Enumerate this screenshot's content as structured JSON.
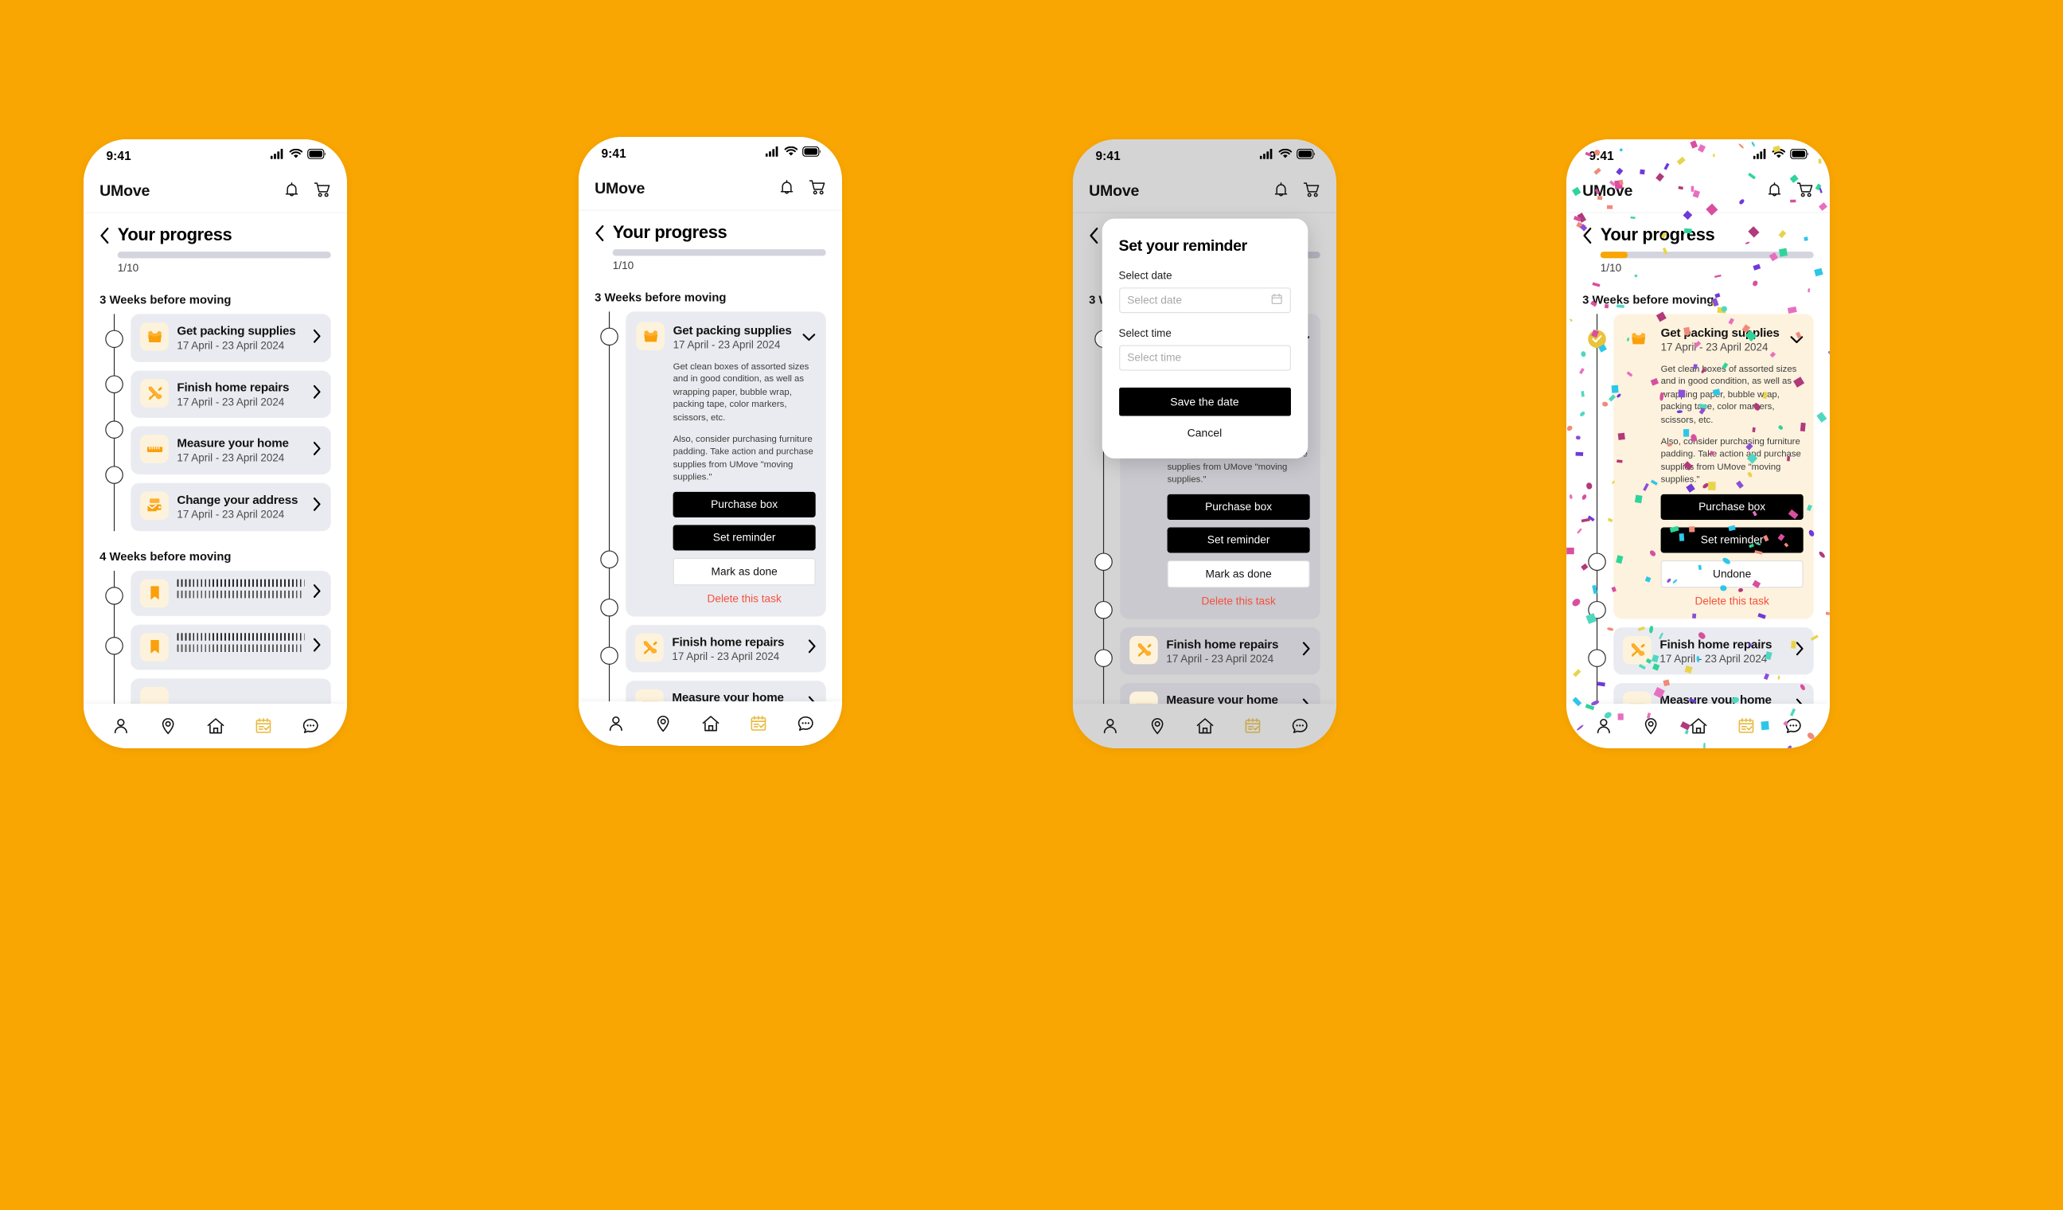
{
  "background_color": "#F9A602",
  "status_bar": {
    "time": "9:41",
    "icons": [
      "signal-icon",
      "wifi-icon",
      "battery-icon"
    ]
  },
  "app_bar": {
    "brand": "UMove",
    "icons": [
      "bell-icon",
      "cart-icon"
    ]
  },
  "page": {
    "title": "Your progress",
    "progress_label": "1/10",
    "progress_percent_empty": 0,
    "progress_percent_filled": 13
  },
  "sections": [
    {
      "title": "3 Weeks before moving"
    },
    {
      "title": "4 Weeks before moving"
    }
  ],
  "tasks": [
    {
      "icon": "box-icon",
      "title": "Get packing supplies",
      "dates": "17 April - 23 April 2024"
    },
    {
      "icon": "tools-icon",
      "title": "Finish home repairs",
      "dates": "17 April - 23 April 2024"
    },
    {
      "icon": "ruler-icon",
      "title": "Measure your home",
      "dates": "17 April - 23 April 2024"
    },
    {
      "icon": "mail-icon",
      "title": "Change your address",
      "dates": "17 April - 23 April 2024"
    }
  ],
  "placeholder_tasks": [
    {
      "icon": "bookmark-icon"
    },
    {
      "icon": "bookmark-icon"
    }
  ],
  "expanded_task": {
    "icon": "box-icon",
    "title": "Get packing supplies",
    "dates": "17 April - 23 April 2024",
    "description_1": "Get clean boxes of assorted sizes and in good condition, as well as wrapping paper, bubble wrap, packing tape, color markers, scissors, etc.",
    "description_2": "Also, consider purchasing furniture padding. Take action and purchase supplies from UMove \"moving supplies.\"",
    "purchase_label": "Purchase box",
    "reminder_label": "Set reminder",
    "mark_done_label": "Mark as done",
    "undone_label": "Undone",
    "delete_label": "Delete this task"
  },
  "modal": {
    "title": "Set your reminder",
    "date_label": "Select date",
    "date_placeholder": "Select date",
    "date_value": "",
    "time_label": "Select time",
    "time_placeholder": "Select time",
    "time_value": "",
    "save_label": "Save the date",
    "cancel_label": "Cancel"
  },
  "bottom_nav": [
    {
      "icon": "person-icon",
      "active": false
    },
    {
      "icon": "location-icon",
      "active": false
    },
    {
      "icon": "home-icon",
      "active": false
    },
    {
      "icon": "checklist-icon",
      "active": true
    },
    {
      "icon": "chat-icon",
      "active": false
    }
  ],
  "colors": {
    "accent_orange": "#F9A602",
    "card_grey": "#eaebf0",
    "card_done_cream": "#fdf2dd",
    "tile_cream": "#fdf3dd",
    "delete_red": "#F5503C",
    "check_yellow": "#E8C33C",
    "progress_track": "#d3d4dd"
  },
  "confetti_colors": [
    "#8B4FD8",
    "#2EC6E8",
    "#2FD49A",
    "#E86FC0",
    "#E8D44C",
    "#F08A7A",
    "#B03A7A",
    "#6F3AD8",
    "#4FD8C0",
    "#D84FA0"
  ]
}
